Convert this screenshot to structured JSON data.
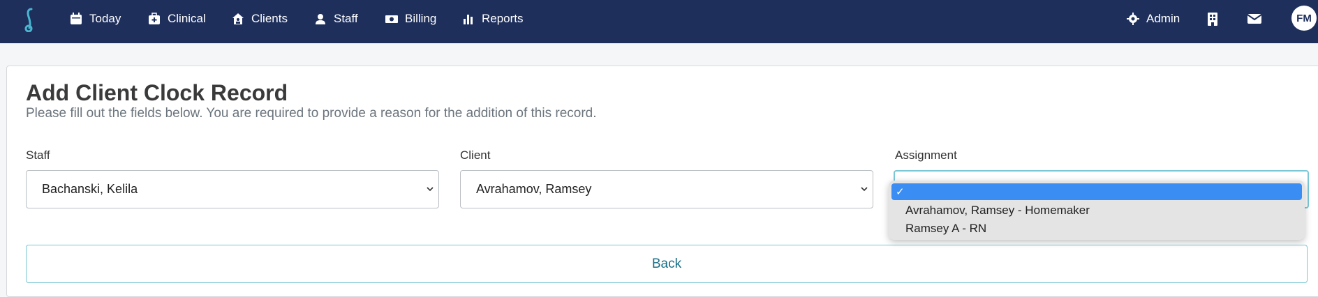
{
  "nav": {
    "items": [
      {
        "label": "Today",
        "icon": "calendar-icon"
      },
      {
        "label": "Clinical",
        "icon": "medical-kit-icon"
      },
      {
        "label": "Clients",
        "icon": "house-user-icon"
      },
      {
        "label": "Staff",
        "icon": "user-nurse-icon"
      },
      {
        "label": "Billing",
        "icon": "money-icon"
      },
      {
        "label": "Reports",
        "icon": "bar-chart-icon"
      }
    ],
    "admin_label": "Admin",
    "avatar_initials": "FM"
  },
  "page": {
    "title": "Add Client Clock Record",
    "subtitle": "Please fill out the fields below. You are required to provide a reason for the addition of this record."
  },
  "form": {
    "staff": {
      "label": "Staff",
      "value": "Bachanski, Kelila"
    },
    "client": {
      "label": "Client",
      "value": "Avrahamov, Ramsey"
    },
    "assignment": {
      "label": "Assignment",
      "value": "",
      "options": [
        "",
        "Avrahamov, Ramsey - Homemaker",
        "Ramsey A - RN"
      ]
    },
    "back_label": "Back"
  },
  "colors": {
    "navbar": "#1e2f5c",
    "accent": "#7ac7d6",
    "selected_option": "#3a8ef3"
  }
}
